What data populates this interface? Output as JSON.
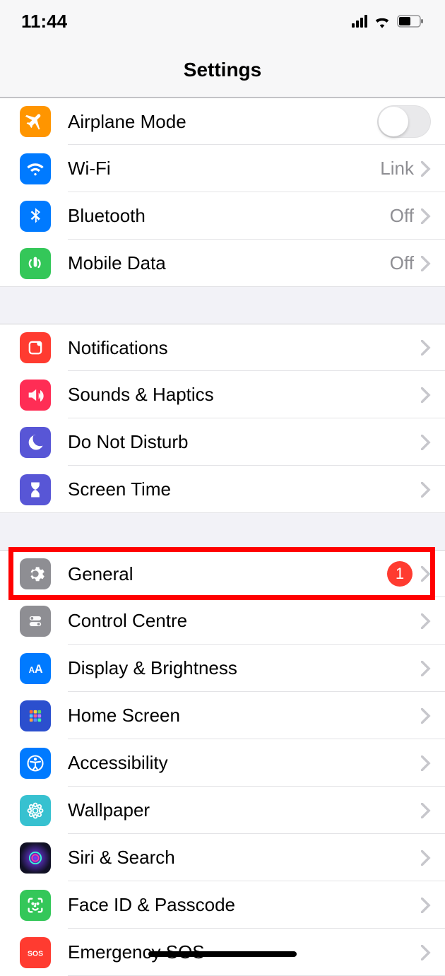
{
  "status": {
    "time": "11:44"
  },
  "header": {
    "title": "Settings"
  },
  "rows": {
    "airplane": {
      "label": "Airplane Mode"
    },
    "wifi": {
      "label": "Wi-Fi",
      "detail": "Link"
    },
    "bluetooth": {
      "label": "Bluetooth",
      "detail": "Off"
    },
    "mobile": {
      "label": "Mobile Data",
      "detail": "Off"
    },
    "notifications": {
      "label": "Notifications"
    },
    "sounds": {
      "label": "Sounds & Haptics"
    },
    "dnd": {
      "label": "Do Not Disturb"
    },
    "screentime": {
      "label": "Screen Time"
    },
    "general": {
      "label": "General",
      "badge": "1"
    },
    "control": {
      "label": "Control Centre"
    },
    "display": {
      "label": "Display & Brightness"
    },
    "homescreen": {
      "label": "Home Screen"
    },
    "accessibility": {
      "label": "Accessibility"
    },
    "wallpaper": {
      "label": "Wallpaper"
    },
    "siri": {
      "label": "Siri & Search"
    },
    "faceid": {
      "label": "Face ID & Passcode"
    },
    "sos": {
      "label": "Emergency SOS"
    }
  },
  "colors": {
    "airplane": "#ff9500",
    "wifi": "#007aff",
    "bluetooth": "#007aff",
    "mobile": "#34c759",
    "notifications": "#ff3b30",
    "sounds": "#ff2d55",
    "dnd": "#5856d6",
    "screentime": "#5856d6",
    "general": "#8e8e93",
    "control": "#8e8e93",
    "display": "#007aff",
    "homescreen": "#2b4fce",
    "accessibility": "#007aff",
    "wallpaper": "#37c1d0",
    "siri": "#111125",
    "faceid": "#34c759",
    "sos": "#ff3b30"
  },
  "highlight": {
    "target": "general"
  }
}
